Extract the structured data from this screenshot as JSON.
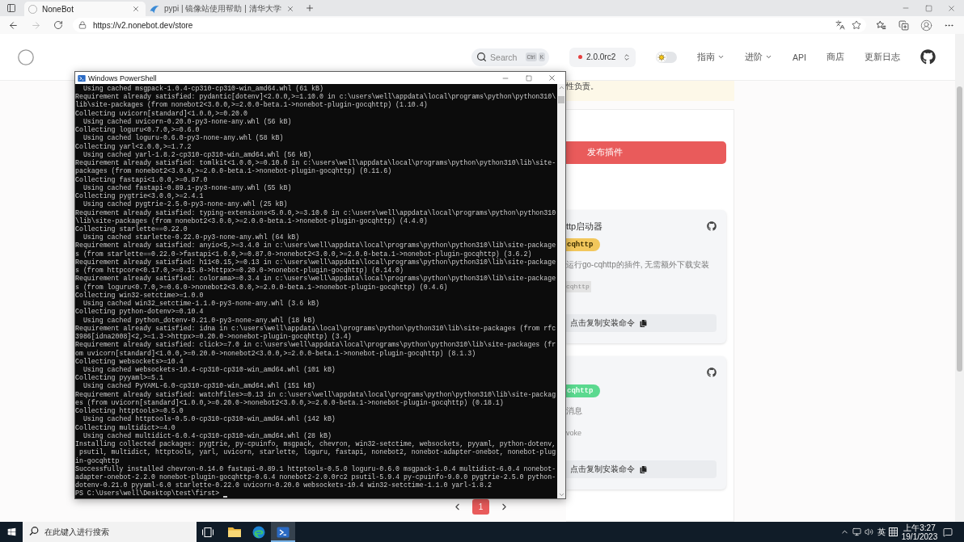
{
  "browser": {
    "tabs": [
      {
        "title": "NoneBot",
        "selected": true
      },
      {
        "title": "pypi | 镜像站使用帮助 | 清华大学",
        "selected": false
      }
    ],
    "address": {
      "url": "https://v2.nonebot.dev/store"
    }
  },
  "site": {
    "header": {
      "search_button": {
        "label": "Search",
        "keys": [
          "Ctrl",
          "K"
        ]
      },
      "version": {
        "label": "2.0.0rc2"
      },
      "theme_toggle": {
        "on": false
      },
      "nav": [
        {
          "label": "指南",
          "kind": "dropdown"
        },
        {
          "label": "进阶",
          "kind": "dropdown"
        },
        {
          "label": "API",
          "kind": "link"
        },
        {
          "label": "商店",
          "kind": "link"
        },
        {
          "label": "更新日志",
          "kind": "link"
        }
      ]
    },
    "notice": "性负责。",
    "publish_button": "发布插件",
    "plugins": [
      {
        "title": "ttp启动器",
        "tag": {
          "label": "cqhttp",
          "color": "#f2c75c"
        },
        "description": "运行go-cqhttp的插件, 无需额外下载安装",
        "meta": {
          "kind": "code",
          "text": "cqhttp"
        },
        "copy_label": "点击复制安装命令"
      },
      {
        "tag": {
          "label": "cqhttp",
          "color": "#5bd98f"
        },
        "description": "消息",
        "meta": {
          "kind": "text",
          "text": "voke"
        },
        "copy_label": "点击复制安装命令"
      }
    ],
    "pagination": [
      {
        "label": "1",
        "selected": true
      }
    ]
  },
  "powershell": {
    "title": "Windows PowerShell",
    "lines": [
      "  Using cached msgpack-1.0.4-cp310-cp310-win_amd64.whl (61 kB)",
      "Requirement already satisfied: pydantic[dotenv]<2.0.0,>=1.10.0 in c:\\users\\well\\appdata\\local\\programs\\python\\python310\\",
      "lib\\site-packages (from nonebot2<3.0.0,>=2.0.0-beta.1->nonebot-plugin-gocqhttp) (1.10.4)",
      "Collecting uvicorn[standard]<1.0.0,>=0.20.0",
      "  Using cached uvicorn-0.20.0-py3-none-any.whl (56 kB)",
      "Collecting loguru<0.7.0,>=0.6.0",
      "  Using cached loguru-0.6.0-py3-none-any.whl (58 kB)",
      "Collecting yarl<2.0.0,>=1.7.2",
      "  Using cached yarl-1.8.2-cp310-cp310-win_amd64.whl (56 kB)",
      "Requirement already satisfied: tomlkit<1.0.0,>=0.10.0 in c:\\users\\well\\appdata\\local\\programs\\python\\python310\\lib\\site-",
      "packages (from nonebot2<3.0.0,>=2.0.0-beta.1->nonebot-plugin-gocqhttp) (0.11.6)",
      "Collecting fastapi<1.0.0,>=0.87.0",
      "  Using cached fastapi-0.89.1-py3-none-any.whl (55 kB)",
      "Collecting pygtrie<3.0.0,>=2.4.1",
      "  Using cached pygtrie-2.5.0-py3-none-any.whl (25 kB)",
      "Requirement already satisfied: typing-extensions<5.0.0,>=3.10.0 in c:\\users\\well\\appdata\\local\\programs\\python\\python310",
      "\\lib\\site-packages (from nonebot2<3.0.0,>=2.0.0-beta.1->nonebot-plugin-gocqhttp) (4.4.0)",
      "Collecting starlette==0.22.0",
      "  Using cached starlette-0.22.0-py3-none-any.whl (64 kB)",
      "Requirement already satisfied: anyio<5,>=3.4.0 in c:\\users\\well\\appdata\\local\\programs\\python\\python310\\lib\\site-package",
      "s (from starlette==0.22.0->fastapi<1.0.0,>=0.87.0->nonebot2<3.0.0,>=2.0.0-beta.1->nonebot-plugin-gocqhttp) (3.6.2)",
      "Requirement already satisfied: h11<0.15,>=0.13 in c:\\users\\well\\appdata\\local\\programs\\python\\python310\\lib\\site-package",
      "s (from httpcore<0.17.0,>=0.15.0->httpx>=0.20.0->nonebot-plugin-gocqhttp) (0.14.0)",
      "Requirement already satisfied: colorama>=0.3.4 in c:\\users\\well\\appdata\\local\\programs\\python\\python310\\lib\\site-package",
      "s (from loguru<0.7.0,>=0.6.0->nonebot2<3.0.0,>=2.0.0-beta.1->nonebot-plugin-gocqhttp) (0.4.6)",
      "Collecting win32-setctime>=1.0.0",
      "  Using cached win32_setctime-1.1.0-py3-none-any.whl (3.6 kB)",
      "Collecting python-dotenv>=0.10.4",
      "  Using cached python_dotenv-0.21.0-py3-none-any.whl (18 kB)",
      "Requirement already satisfied: idna in c:\\users\\well\\appdata\\local\\programs\\python\\python310\\lib\\site-packages (from rfc",
      "3986[idna2008]<2,>=1.3->httpx>=0.20.0->nonebot-plugin-gocqhttp) (3.4)",
      "Requirement already satisfied: click>=7.0 in c:\\users\\well\\appdata\\local\\programs\\python\\python310\\lib\\site-packages (fr",
      "om uvicorn[standard]<1.0.0,>=0.20.0->nonebot2<3.0.0,>=2.0.0-beta.1->nonebot-plugin-gocqhttp) (8.1.3)",
      "Collecting websockets>=10.4",
      "  Using cached websockets-10.4-cp310-cp310-win_amd64.whl (101 kB)",
      "Collecting pyyaml>=5.1",
      "  Using cached PyYAML-6.0-cp310-cp310-win_amd64.whl (151 kB)",
      "Requirement already satisfied: watchfiles>=0.13 in c:\\users\\well\\appdata\\local\\programs\\python\\python310\\lib\\site-packag",
      "es (from uvicorn[standard]<1.0.0,>=0.20.0->nonebot2<3.0.0,>=2.0.0-beta.1->nonebot-plugin-gocqhttp) (0.18.1)",
      "Collecting httptools>=0.5.0",
      "  Using cached httptools-0.5.0-cp310-cp310-win_amd64.whl (142 kB)",
      "Collecting multidict>=4.0",
      "  Using cached multidict-6.0.4-cp310-cp310-win_amd64.whl (28 kB)",
      "Installing collected packages: pygtrie, py-cpuinfo, msgpack, chevron, win32-setctime, websockets, pyyaml, python-dotenv,",
      " psutil, multidict, httptools, yarl, uvicorn, starlette, loguru, fastapi, nonebot2, nonebot-adapter-onebot, nonebot-plug",
      "in-gocqhttp",
      "Successfully installed chevron-0.14.0 fastapi-0.89.1 httptools-0.5.0 loguru-0.6.0 msgpack-1.0.4 multidict-6.0.4 nonebot-",
      "adapter-onebot-2.2.0 nonebot-plugin-gocqhttp-0.6.4 nonebot2-2.0.0rc2 psutil-5.9.4 py-cpuinfo-9.0.0 pygtrie-2.5.0 python-",
      "dotenv-0.21.0 pyyaml-6.0 starlette-0.22.0 uvicorn-0.20.0 websockets-10.4 win32-setctime-1.1.0 yarl-1.8.2",
      "PS C:\\Users\\well\\Desktop\\test\\first>"
    ]
  },
  "taskbar": {
    "search": {
      "placeholder": "在此键入进行搜索"
    },
    "apps": [
      {
        "kind": "explorer",
        "active": false
      },
      {
        "kind": "edge",
        "active": false
      },
      {
        "kind": "powershell",
        "active": true
      }
    ],
    "tray": {
      "language": "英",
      "time": "上午3:27",
      "date": "19/1/2023"
    }
  }
}
